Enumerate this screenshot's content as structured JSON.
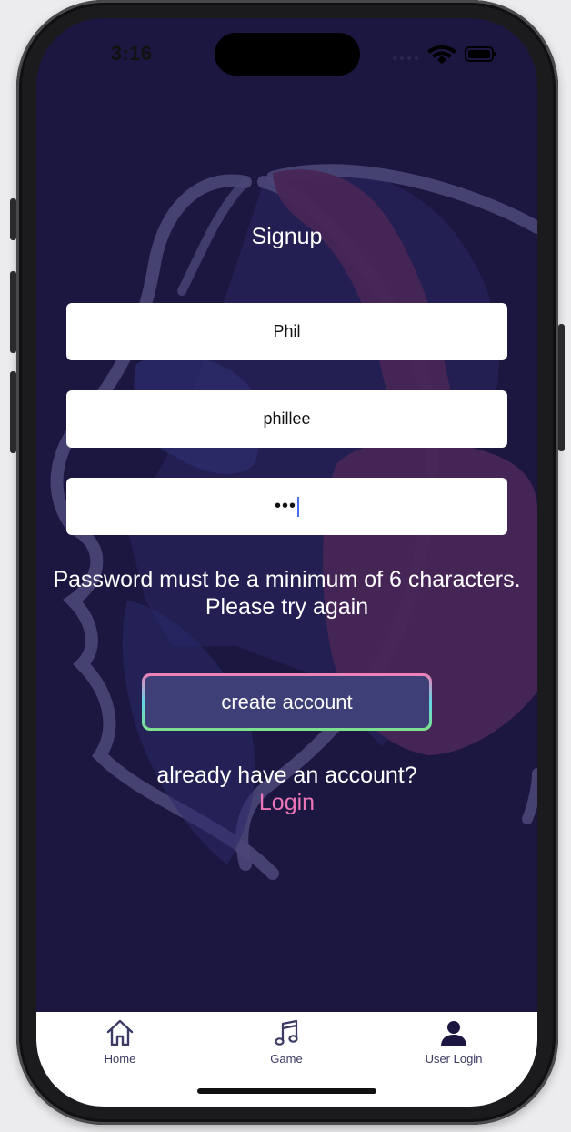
{
  "status_bar": {
    "time": "3:16"
  },
  "signup": {
    "title": "Signup",
    "name_value": "Phil",
    "username_value": "phillee",
    "password_mask": "•••",
    "error_message_line1": "Password must be a minimum of 6 characters.",
    "error_message_line2": "Please try again",
    "create_button_label": "create account",
    "already_text": "already have an account?",
    "login_link": "Login"
  },
  "tabs": [
    {
      "label": "Home",
      "icon": "home-icon"
    },
    {
      "label": "Game",
      "icon": "music-note-icon"
    },
    {
      "label": "User Login",
      "icon": "user-icon"
    }
  ],
  "colors": {
    "background": "#1b1740",
    "accent_pink": "#ee76b8",
    "button_fill": "#3f3f77",
    "tab_label": "#3b3a64"
  }
}
